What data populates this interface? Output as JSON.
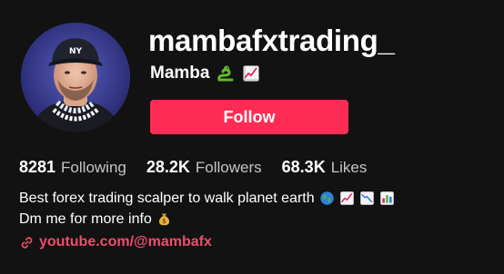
{
  "profile": {
    "username": "mambafxtrading_",
    "nickname": "Mamba",
    "nickname_emojis": [
      "snake-emoji",
      "chart-increasing-emoji"
    ],
    "follow_label": "Follow",
    "accent_color": "#fe2c55",
    "stats": [
      {
        "value": "8281",
        "label": "Following"
      },
      {
        "value": "28.2K",
        "label": "Followers"
      },
      {
        "value": "68.3K",
        "label": "Likes"
      }
    ],
    "bio": {
      "line1": "Best forex trading scalper to walk planet earth",
      "line1_emojis": [
        "globe-emoji",
        "chart-increasing-emoji",
        "chart-decreasing-emoji",
        "bar-chart-emoji"
      ],
      "line2": "Dm me for more info",
      "line2_emojis": [
        "money-bag-emoji"
      ]
    },
    "link": {
      "text": "youtube.com/@mambafx",
      "icon": "link-icon",
      "color": "#ee4d6a"
    }
  }
}
